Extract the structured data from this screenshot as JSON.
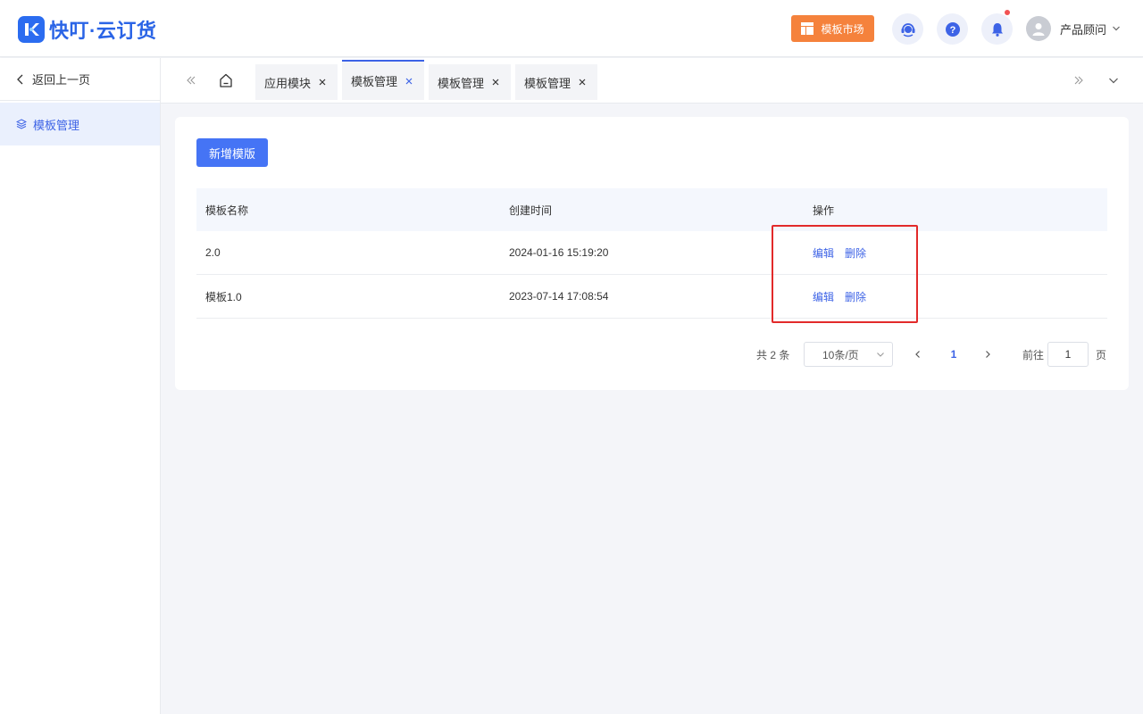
{
  "header": {
    "app_name": "快叮·云订货",
    "market_label": "模板市场",
    "user_name": "产品顾问"
  },
  "sidebar": {
    "back_label": "返回上一页",
    "items": [
      {
        "label": "模板管理",
        "active": true
      }
    ]
  },
  "tabs": [
    {
      "label": "应用模块",
      "active": false
    },
    {
      "label": "模板管理",
      "active": true
    },
    {
      "label": "模板管理",
      "active": false
    },
    {
      "label": "模板管理",
      "active": false
    }
  ],
  "main": {
    "add_button": "新增模版",
    "table": {
      "columns": [
        "模板名称",
        "创建时间",
        "操作"
      ],
      "rows": [
        {
          "name": "2.0",
          "created": "2024-01-16 15:19:20",
          "edit": "编辑",
          "delete": "删除"
        },
        {
          "name": "模板1.0",
          "created": "2023-07-14 17:08:54",
          "edit": "编辑",
          "delete": "删除"
        }
      ]
    },
    "pagination": {
      "total_text": "共 2 条",
      "page_size": "10条/页",
      "current_page": "1",
      "goto_label": "前往",
      "goto_value": "1",
      "goto_suffix": "页"
    }
  },
  "colors": {
    "primary": "#3d63e6",
    "market": "#f5823c",
    "highlight": "#e22a2a"
  }
}
